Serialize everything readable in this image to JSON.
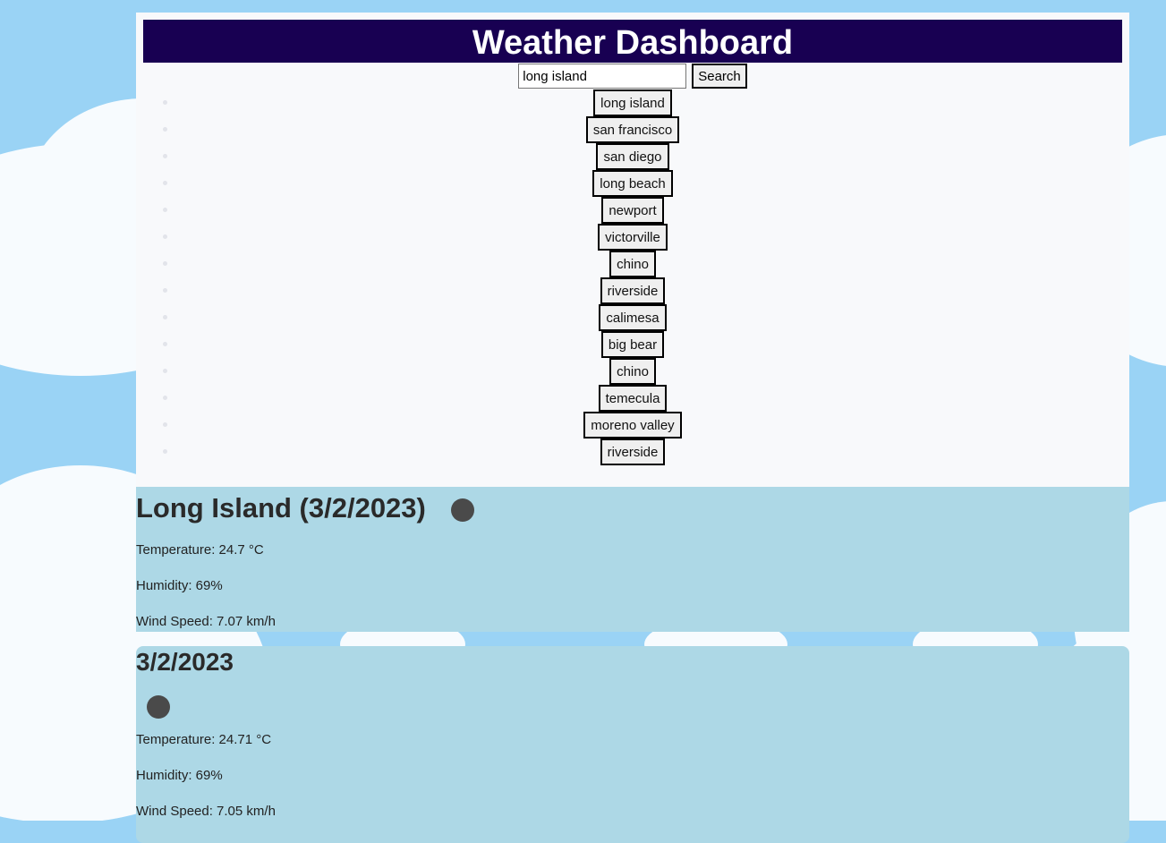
{
  "header": {
    "title": "Weather Dashboard"
  },
  "search": {
    "value": "long island",
    "button_label": "Search"
  },
  "history": [
    "long island",
    "san francisco",
    "san diego",
    "long beach",
    "newport",
    "victorville",
    "chino",
    "riverside",
    "calimesa",
    "big bear",
    "chino",
    "temecula",
    "moreno valley",
    "riverside"
  ],
  "current": {
    "heading": "Long Island (3/2/2023)",
    "icon": "weather-icon",
    "temperature": "Temperature: 24.7 °C",
    "humidity": "Humidity: 69%",
    "wind": "Wind Speed: 7.07 km/h"
  },
  "forecast": {
    "date": "3/2/2023",
    "icon": "weather-icon",
    "temperature": "Temperature: 24.71 °C",
    "humidity": "Humidity: 69%",
    "wind": "Wind Speed: 7.05 km/h"
  },
  "colors": {
    "banner": "#180052",
    "card": "#add8e6",
    "sky": "#9ad3f5"
  }
}
